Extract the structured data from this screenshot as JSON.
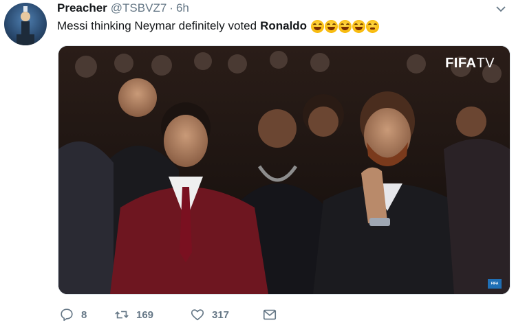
{
  "tweet": {
    "display_name": "Preacher",
    "handle": "@TSBVZ7",
    "separator": "·",
    "time": "6h",
    "text_plain": "Messi thinking Neymar definitely voted",
    "text_bold": "Ronaldo",
    "emoji_names": [
      "joy-emoji",
      "joy-emoji",
      "joy-emoji",
      "joy-emoji",
      "sneezing-face-emoji"
    ],
    "media": {
      "watermark_bold": "FIFA",
      "watermark_light": "TV",
      "corner_badge": "FIFA"
    },
    "stats": {
      "replies": "8",
      "retweets": "169",
      "likes": "317"
    }
  },
  "icons": {
    "menu": "chevron-down-icon",
    "reply": "reply-icon",
    "retweet": "retweet-icon",
    "like": "heart-icon",
    "dm": "envelope-icon"
  },
  "colors": {
    "text": "#14171a",
    "muted": "#657786",
    "border": "#e1e8ed"
  }
}
